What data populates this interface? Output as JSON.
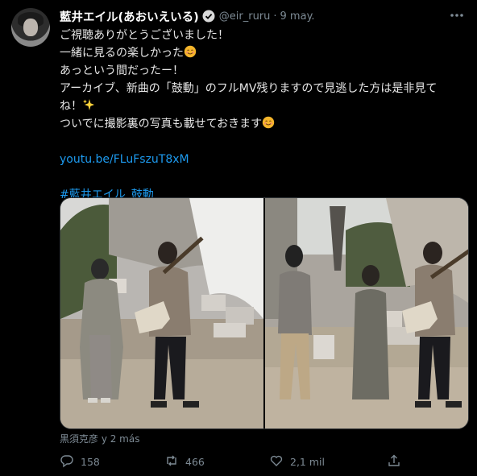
{
  "tweet": {
    "author_name": "藍井エイル(あおいえいる)",
    "handle": "@eir_ruru",
    "separator": "·",
    "date": "9 may.",
    "lines": [
      "ご視聴ありがとうございました！",
      "一緒に見るの楽しかった",
      "あっという間だったー！",
      "アーカイブ、新曲の「鼓動」のフルMV残りますので見逃した方は是非見て",
      "ね！",
      "ついでに撮影裏の写真も載せておきます"
    ],
    "link": "youtu.be/FLuFszuT8xM",
    "hashtag": "#藍井エイル_鼓動",
    "tagged_people": "黒須克彦 y 2 más",
    "replies": "158",
    "retweets": "466",
    "likes": "2,1 mil"
  },
  "icons": {
    "verified": "verified-badge-icon",
    "more": "more-options-icon",
    "smile": "smiling-face-emoji",
    "sparkles": "sparkles-emoji",
    "reply": "reply-icon",
    "retweet": "retweet-icon",
    "like": "like-icon",
    "share": "share-icon"
  },
  "colors": {
    "background": "#000000",
    "text": "#e7e7e7",
    "muted": "#7d8a94",
    "link": "#1d9bf0"
  }
}
